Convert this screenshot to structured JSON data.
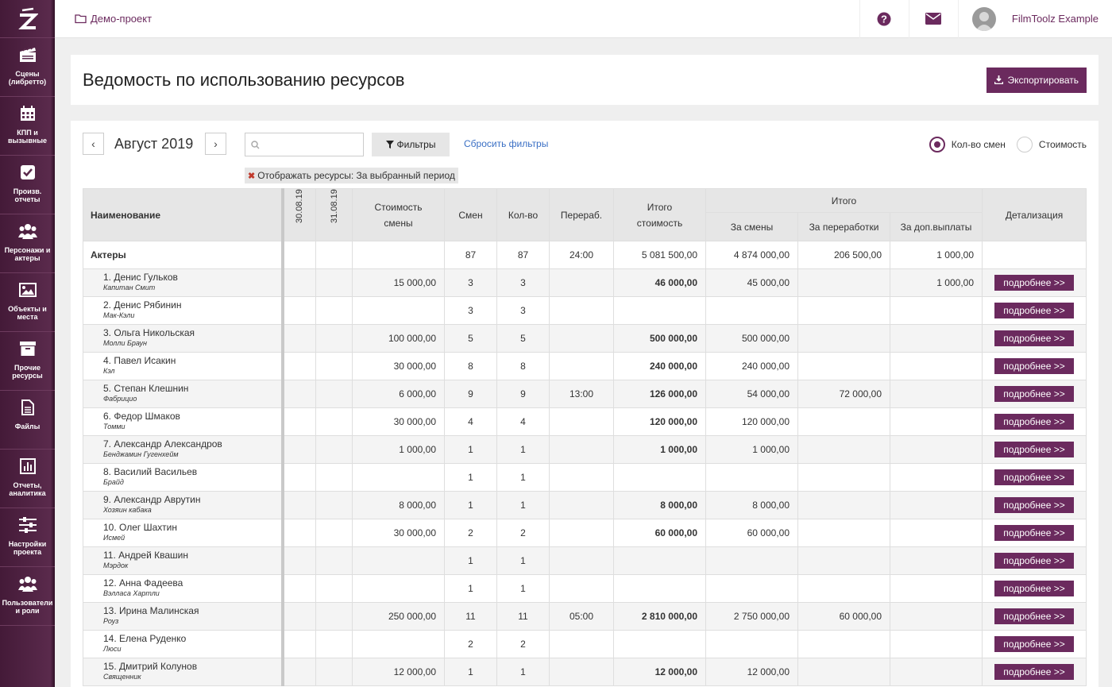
{
  "sidebar": {
    "items": [
      {
        "label": "Сцены (либретто)",
        "icon": "clapperboard-icon"
      },
      {
        "label": "КПП и вызывные",
        "icon": "calendar-icon"
      },
      {
        "label": "Произв. отчеты",
        "icon": "checkbox-icon"
      },
      {
        "label": "Персонажи и актеры",
        "icon": "people-icon"
      },
      {
        "label": "Объекты и места",
        "icon": "image-icon"
      },
      {
        "label": "Прочие ресурсы",
        "icon": "archive-box-icon"
      },
      {
        "label": "Файлы",
        "icon": "file-icon"
      },
      {
        "label": "Отчеты, аналитика",
        "icon": "bar-chart-icon"
      },
      {
        "label": "Настройки проекта",
        "icon": "sliders-icon"
      },
      {
        "label": "Пользователи и роли",
        "icon": "users-icon"
      }
    ]
  },
  "topbar": {
    "project": "Демо-проект",
    "user_name": "FilmToolz Example"
  },
  "page": {
    "title": "Ведомость по использованию ресурсов",
    "export_label": "Экспортировать"
  },
  "toolbar": {
    "prev": "‹",
    "next": "›",
    "month": "Август 2019",
    "search_placeholder": "",
    "filters_label": "Фильтры",
    "reset_label": "Сбросить фильтры",
    "radio1": "Кол-во смен",
    "radio2": "Стоимость",
    "chip_label": "Отображать ресурсы:",
    "chip_value": "За выбранный период"
  },
  "table": {
    "headers": {
      "name": "Наименование",
      "d1": "30.08.19",
      "d2": "31.08.19",
      "cost": "Стоимость смены",
      "shifts": "Смен",
      "qty": "Кол-во",
      "overtime": "Перераб.",
      "total": "Итого стоимость",
      "itogo": "Итого",
      "by_shifts": "За смены",
      "by_overtime": "За переработки",
      "by_extra": "За доп.выплаты",
      "detail": "Детализация"
    },
    "group": {
      "name": "Актеры",
      "shifts": "87",
      "qty": "87",
      "overtime": "24:00",
      "total": "5 081 500,00",
      "by_shifts": "4 874 000,00",
      "by_overtime": "206 500,00",
      "by_extra": "1 000,00"
    },
    "more_label": "подробнее >>",
    "rows": [
      {
        "name": "1. Денис Гульков",
        "role": "Капитан Смит",
        "cost": "15 000,00",
        "shifts": "3",
        "qty": "3",
        "overtime": "",
        "total": "46 000,00",
        "by_shifts": "45 000,00",
        "by_overtime": "",
        "by_extra": "1 000,00"
      },
      {
        "name": "2. Денис Рябинин",
        "role": "Мак-Кэли",
        "cost": "",
        "shifts": "3",
        "qty": "3",
        "overtime": "",
        "total": "",
        "by_shifts": "",
        "by_overtime": "",
        "by_extra": ""
      },
      {
        "name": "3. Ольга Никольская",
        "role": "Молли Браун",
        "cost": "100 000,00",
        "shifts": "5",
        "qty": "5",
        "overtime": "",
        "total": "500 000,00",
        "by_shifts": "500 000,00",
        "by_overtime": "",
        "by_extra": ""
      },
      {
        "name": "4. Павел Исакин",
        "role": "Кэл",
        "cost": "30 000,00",
        "shifts": "8",
        "qty": "8",
        "overtime": "",
        "total": "240 000,00",
        "by_shifts": "240 000,00",
        "by_overtime": "",
        "by_extra": ""
      },
      {
        "name": "5. Степан Клешнин",
        "role": "Фабрицио",
        "cost": "6 000,00",
        "shifts": "9",
        "qty": "9",
        "overtime": "13:00",
        "total": "126 000,00",
        "by_shifts": "54 000,00",
        "by_overtime": "72 000,00",
        "by_extra": ""
      },
      {
        "name": "6. Федор Шмаков",
        "role": "Томми",
        "cost": "30 000,00",
        "shifts": "4",
        "qty": "4",
        "overtime": "",
        "total": "120 000,00",
        "by_shifts": "120 000,00",
        "by_overtime": "",
        "by_extra": ""
      },
      {
        "name": "7. Александр Александров",
        "role": "Бенджамин Гугенхейм",
        "cost": "1 000,00",
        "shifts": "1",
        "qty": "1",
        "overtime": "",
        "total": "1 000,00",
        "by_shifts": "1 000,00",
        "by_overtime": "",
        "by_extra": ""
      },
      {
        "name": "8. Василий Васильев",
        "role": "Брайд",
        "cost": "",
        "shifts": "1",
        "qty": "1",
        "overtime": "",
        "total": "",
        "by_shifts": "",
        "by_overtime": "",
        "by_extra": ""
      },
      {
        "name": "9. Александр Аврутин",
        "role": "Хозяин кабака",
        "cost": "8 000,00",
        "shifts": "1",
        "qty": "1",
        "overtime": "",
        "total": "8 000,00",
        "by_shifts": "8 000,00",
        "by_overtime": "",
        "by_extra": ""
      },
      {
        "name": "10. Олег Шахтин",
        "role": "Исмей",
        "cost": "30 000,00",
        "shifts": "2",
        "qty": "2",
        "overtime": "",
        "total": "60 000,00",
        "by_shifts": "60 000,00",
        "by_overtime": "",
        "by_extra": ""
      },
      {
        "name": "11. Андрей Квашин",
        "role": "Мэрдок",
        "cost": "",
        "shifts": "1",
        "qty": "1",
        "overtime": "",
        "total": "",
        "by_shifts": "",
        "by_overtime": "",
        "by_extra": ""
      },
      {
        "name": "12. Анна Фадеева",
        "role": "Вэлласа Хартли",
        "cost": "",
        "shifts": "1",
        "qty": "1",
        "overtime": "",
        "total": "",
        "by_shifts": "",
        "by_overtime": "",
        "by_extra": ""
      },
      {
        "name": "13. Ирина Малинская",
        "role": "Роуз",
        "cost": "250 000,00",
        "shifts": "11",
        "qty": "11",
        "overtime": "05:00",
        "total": "2 810 000,00",
        "by_shifts": "2 750 000,00",
        "by_overtime": "60 000,00",
        "by_extra": ""
      },
      {
        "name": "14. Елена Руденко",
        "role": "Люси",
        "cost": "",
        "shifts": "2",
        "qty": "2",
        "overtime": "",
        "total": "",
        "by_shifts": "",
        "by_overtime": "",
        "by_extra": ""
      },
      {
        "name": "15. Дмитрий Колунов",
        "role": "Священник",
        "cost": "12 000,00",
        "shifts": "1",
        "qty": "1",
        "overtime": "",
        "total": "12 000,00",
        "by_shifts": "12 000,00",
        "by_overtime": "",
        "by_extra": ""
      }
    ]
  },
  "colors": {
    "brand": "#6b2a5e",
    "sidebar": "#4f2244",
    "link": "#3a6fc4"
  }
}
